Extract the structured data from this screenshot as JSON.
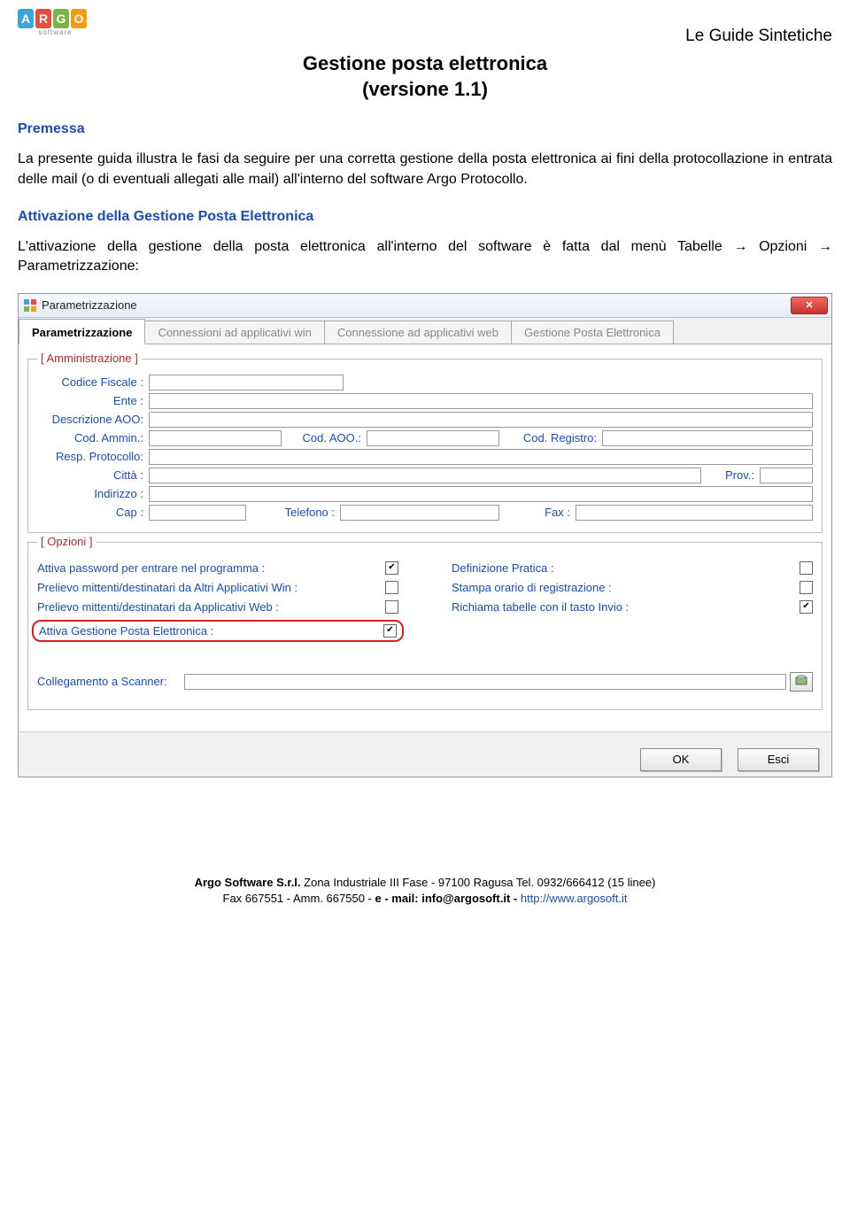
{
  "header": {
    "logo_letters": [
      "A",
      "R",
      "G",
      "O"
    ],
    "logo_sub": "software",
    "subtitle": "Le Guide Sintetiche"
  },
  "doc": {
    "title_l1": "Gestione posta elettronica",
    "title_l2": "(versione 1.1)"
  },
  "s1": {
    "h": "Premessa",
    "p": "La presente guida illustra le fasi da seguire per una corretta gestione della posta elettronica ai fini della protocollazione in entrata delle mail (o di eventuali allegati alle mail) all'interno del software Argo Protocollo."
  },
  "s2": {
    "h": "Attivazione della Gestione Posta Elettronica",
    "p": "L'attivazione della gestione della posta elettronica all'interno del software è fatta dal menù Tabelle → Opzioni → Parametrizzazione:"
  },
  "win": {
    "title": "Parametrizzazione",
    "tabs": [
      "Parametrizzazione",
      "Connessioni ad applicativi win",
      "Connessione ad applicativi web",
      "Gestione Posta Elettronica"
    ],
    "group1": {
      "title": "[ Amministrazione ]",
      "codice_fiscale": "Codice Fiscale :",
      "ente": "Ente :",
      "descrizione_aoo": "Descrizione AOO:",
      "cod_ammin": "Cod. Ammin.:",
      "cod_aoo": "Cod. AOO.:",
      "cod_registro": "Cod. Registro:",
      "resp_protocollo": "Resp. Protocollo:",
      "citta": "Città :",
      "prov": "Prov.:",
      "indirizzo": "Indirizzo :",
      "cap": "Cap :",
      "telefono": "Telefono :",
      "fax": "Fax :"
    },
    "group2": {
      "title": "[ Opzioni ]",
      "left": [
        {
          "label": "Attiva password per entrare nel programma :",
          "checked": true
        },
        {
          "label": "Prelievo mittenti/destinatari da Altri Applicativi Win :",
          "checked": false
        },
        {
          "label": "Prelievo mittenti/destinatari da  Applicativi Web :",
          "checked": false
        },
        {
          "label": "Attiva Gestione Posta Elettronica :",
          "checked": true,
          "highlight": true
        }
      ],
      "right": [
        {
          "label": "Definizione Pratica :",
          "checked": false
        },
        {
          "label": "Stampa orario di registrazione :",
          "checked": false
        },
        {
          "label": "Richiama tabelle con il tasto Invio :",
          "checked": true
        }
      ]
    },
    "scanner_label": "Collegamento a Scanner:",
    "buttons": {
      "ok": "OK",
      "esci": "Esci"
    }
  },
  "footer": {
    "l1a": "Argo Software S.r.l.",
    "l1b": " Zona Industriale III Fase - 97100 Ragusa Tel. 0932/666412 (15 linee)",
    "l2a": "Fax 667551 - Amm. 667550 - ",
    "l2b": "e - mail: info@argosoft.it - ",
    "l2c": "  http://www.argosoft.it"
  }
}
